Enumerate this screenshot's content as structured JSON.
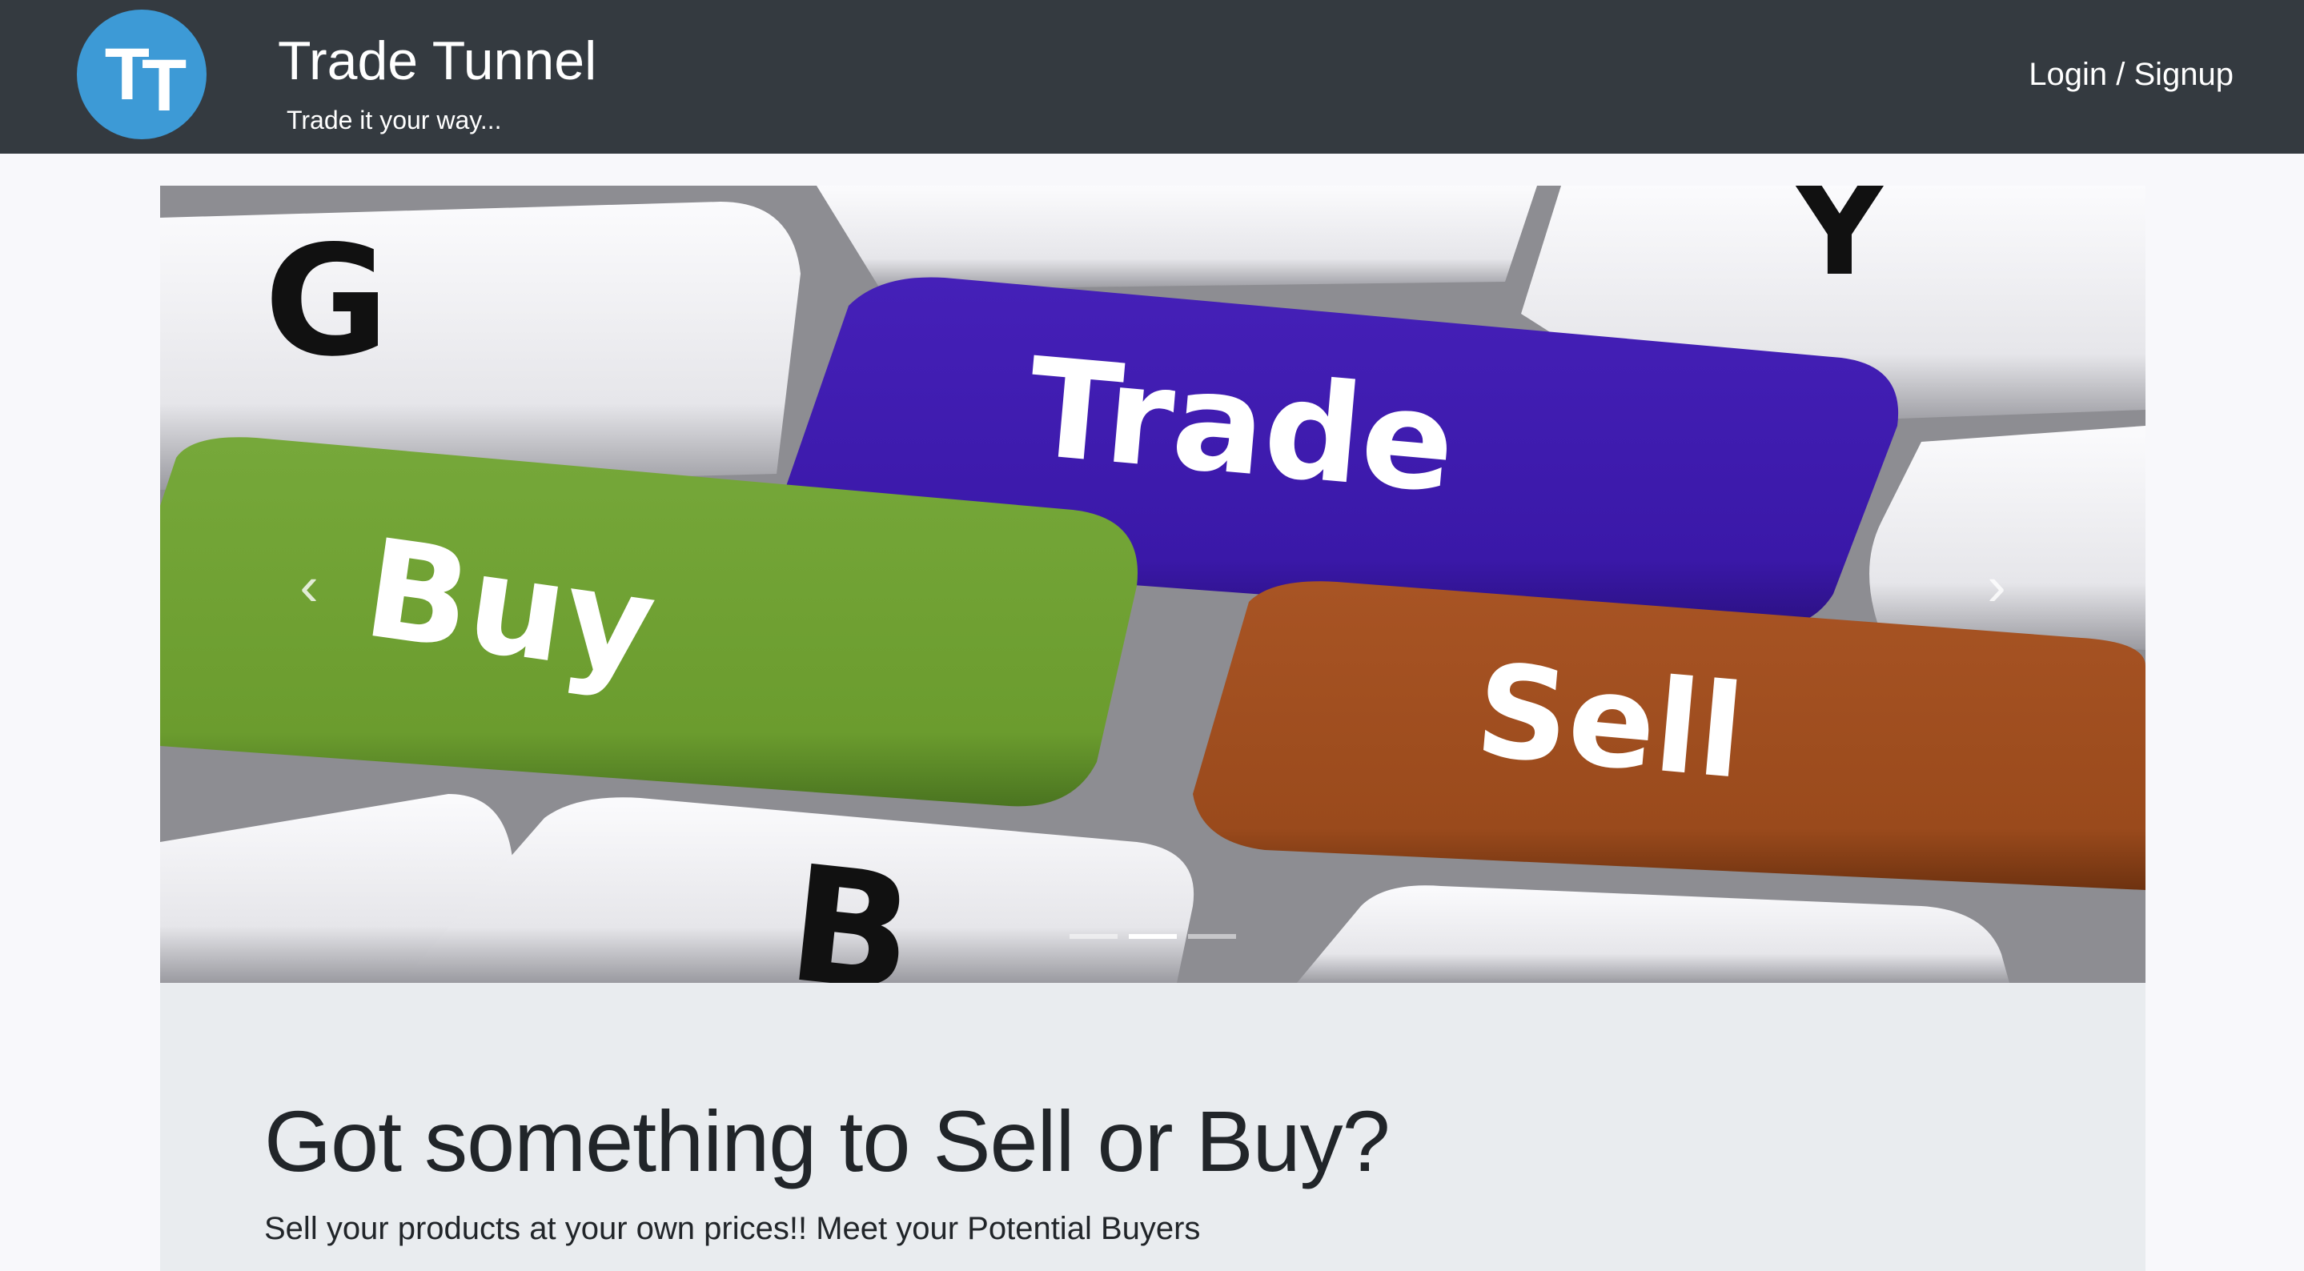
{
  "header": {
    "logo_text": "TT",
    "title": "Trade Tunnel",
    "tagline": "Trade it your way...",
    "login_label": "Login / Signup"
  },
  "carousel": {
    "slide": {
      "keys": [
        "G",
        "Trade",
        "Buy",
        "Sell",
        "B",
        "Y"
      ],
      "key_colors": {
        "trade": "#3a18a8",
        "buy": "#6b9c2e",
        "sell": "#9a4a1c"
      }
    },
    "prev_icon": "chevron-left-icon",
    "next_icon": "chevron-right-icon",
    "indicator_count": 3,
    "active_index": 1
  },
  "hero": {
    "headline": "Got something to Sell or Buy?",
    "subline": "Sell your products at your own prices!! Meet your Potential Buyers"
  },
  "colors": {
    "navbar": "#343a40",
    "logo": "#3d9ad6",
    "jumbotron": "#e9ecef"
  }
}
